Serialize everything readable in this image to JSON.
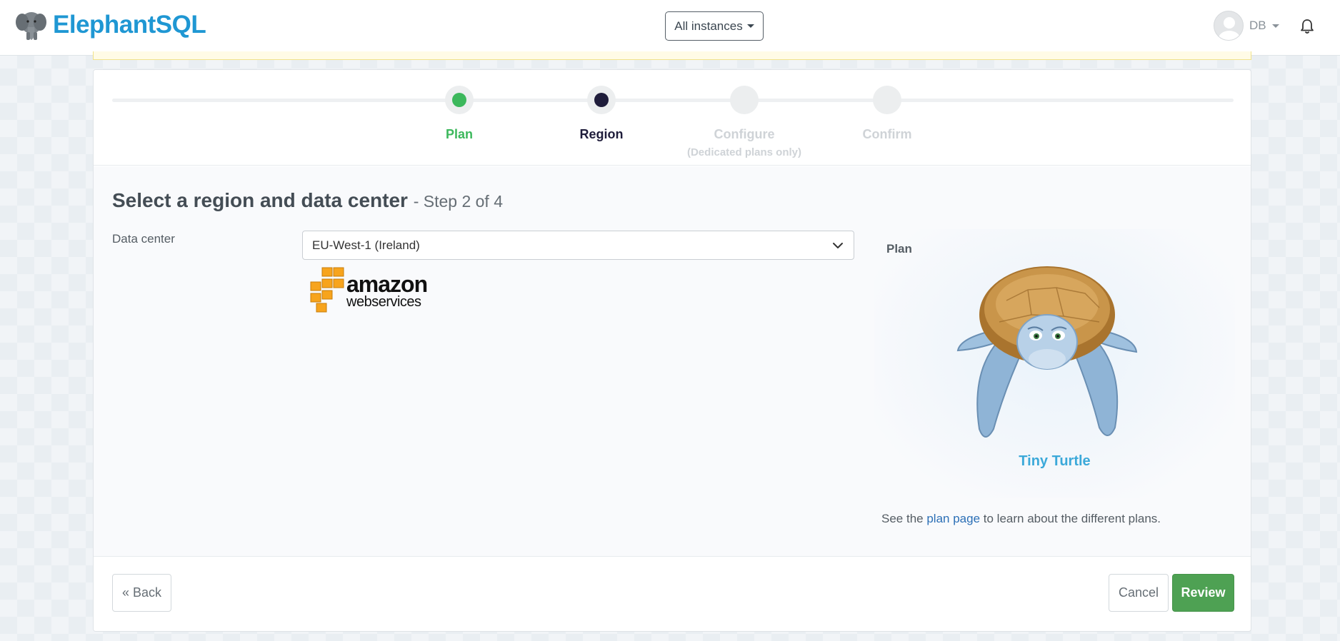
{
  "header": {
    "brand": "ElephantSQL",
    "instances_button": "All instances",
    "user_initials": "DB"
  },
  "stepper": {
    "steps": [
      {
        "label": "Plan",
        "state": "done"
      },
      {
        "label": "Region",
        "state": "active"
      },
      {
        "label": "Configure",
        "sublabel": "(Dedicated plans only)",
        "state": "pending"
      },
      {
        "label": "Confirm",
        "state": "pending"
      }
    ]
  },
  "main": {
    "title": "Select a region and data center",
    "title_step": "- Step 2 of 4",
    "data_center_label": "Data center",
    "data_center_value": "EU-West-1 (Ireland)",
    "provider_logo": {
      "word": "amazon",
      "sub": "webservices"
    }
  },
  "plan_panel": {
    "label": "Plan",
    "plan_name": "Tiny Turtle",
    "note_prefix": "See the",
    "note_link": "plan page",
    "note_suffix": "to learn about the different plans."
  },
  "footer": {
    "back_label": "« Back",
    "cancel_label": "Cancel",
    "review_label": "Review"
  },
  "colors": {
    "brand": "#1f97d3",
    "step_done": "#3cb85c",
    "step_active": "#1f1d3b",
    "step_pending": "#cfd3d7",
    "review_button": "#4ea153",
    "link": "#2b6fb6",
    "plan_name": "#3ba9d9"
  }
}
